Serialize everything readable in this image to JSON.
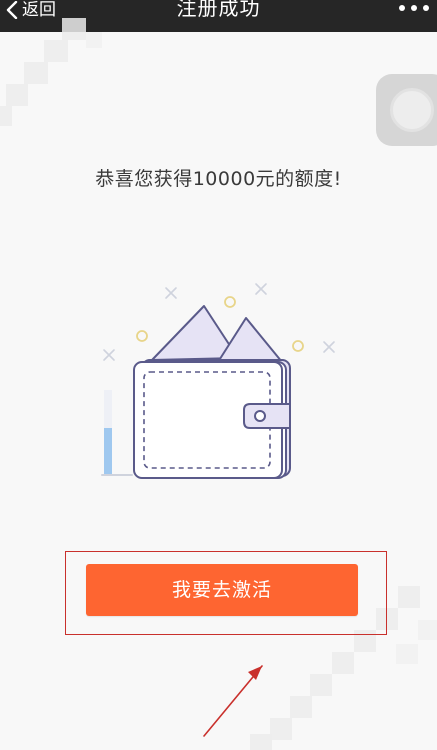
{
  "nav": {
    "back_label": "返回",
    "title": "注册成功"
  },
  "content": {
    "headline": "恭喜您获得10000元的额度!"
  },
  "actions": {
    "activate_label": "我要去激活"
  },
  "colors": {
    "navbar_bg": "#262626",
    "button_bg": "#fe6531",
    "annotation": "#c9302c",
    "wallet_stroke": "#5a5a8a",
    "wallet_fill": "#e6e3f5"
  },
  "icons": {
    "back": "chevron-left-icon",
    "more": "more-dots-icon",
    "float": "assistive-touch-icon",
    "illustration": "wallet-illustration",
    "annotation_arrow": "arrow-up-right-icon"
  }
}
